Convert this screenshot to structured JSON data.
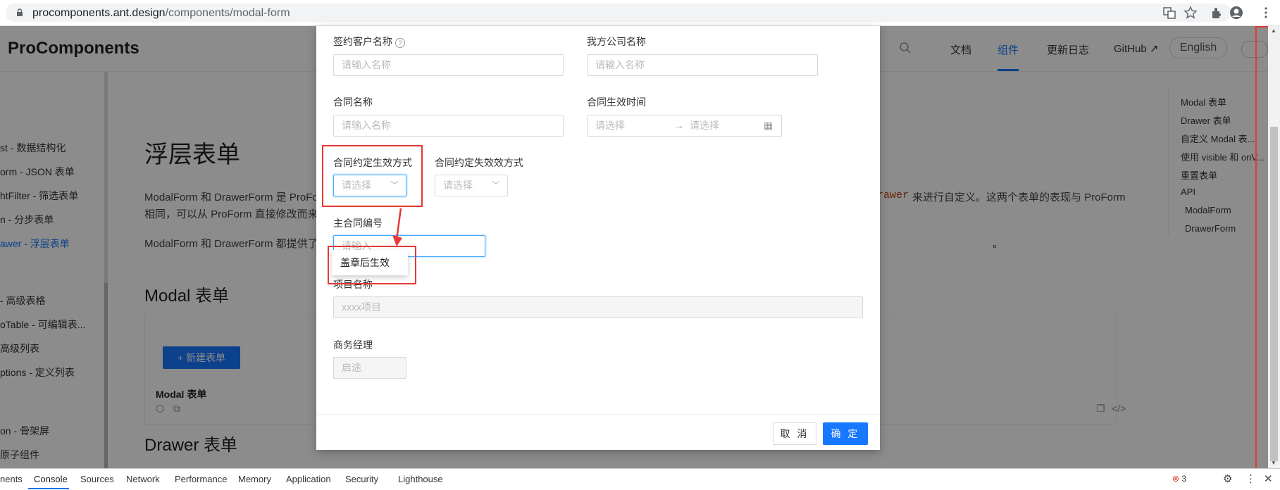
{
  "browser": {
    "url_host": "procomponents.ant.design",
    "url_path": "/components/modal-form"
  },
  "header": {
    "logo": "ProComponents",
    "nav": [
      "文档",
      "组件",
      "更新日志",
      "GitHub",
      "English"
    ],
    "active_nav": "组件"
  },
  "sidebar": {
    "items": [
      "st - 数据结构化",
      "orm - JSON 表单",
      "htFilter - 筛选表单",
      "n - 分步表单",
      "awer - 浮层表单",
      "- 高级表格",
      "oTable - 可编辑表...",
      "高级列表",
      "ptions - 定义列表",
      "on - 骨架屏",
      "原子组件"
    ]
  },
  "content": {
    "title": "浮层表单",
    "para1a": "ModalForm 和 DrawerForm 是 ProFo",
    "para1b": "rawer",
    "para1c": "来进行自定义。这两个表单的表现与 ProForm",
    "para2": "相同，可以从 ProForm 直接修改而来",
    "para3a": "ModalForm 和 DrawerForm 都提供了",
    "para3b": "。",
    "section1": "Modal 表单",
    "new_button": "新建表单",
    "demo_title": "Modal 表单",
    "section2": "Drawer 表单"
  },
  "toc": {
    "items": [
      "Modal 表单",
      "Drawer 表单",
      "自定义 Modal 表...",
      "使用 visible 和 onV...",
      "重置表单",
      "API",
      "ModalForm",
      "DrawerForm"
    ]
  },
  "modal": {
    "fields": {
      "client_name": {
        "label": "签约客户名称",
        "placeholder": "请输入名称"
      },
      "company_name": {
        "label": "我方公司名称",
        "placeholder": "请输入名称"
      },
      "contract_name": {
        "label": "合同名称",
        "placeholder": "请输入名称"
      },
      "effective_time": {
        "label": "合同生效时间",
        "start_placeholder": "请选择",
        "end_placeholder": "请选择"
      },
      "effective_method": {
        "label": "合同约定生效方式",
        "placeholder": "请选择"
      },
      "expire_method": {
        "label": "合同约定失效效方式",
        "placeholder": "请选择"
      },
      "main_contract_no": {
        "label": "主合同编号",
        "placeholder": "请输入"
      },
      "project_name": {
        "label": "项目名称",
        "placeholder": "xxxx项目"
      },
      "business_manager": {
        "label": "商务经理",
        "placeholder": "启途"
      }
    },
    "dropdown_option": "盖章后生效",
    "cancel": "取 消",
    "ok": "确 定"
  },
  "devtools": {
    "tabs": [
      "nents",
      "Console",
      "Sources",
      "Network",
      "Performance",
      "Memory",
      "Application",
      "Security",
      "Lighthouse"
    ],
    "active_tab": "Console",
    "error_count": "3"
  },
  "colors": {
    "primary": "#1677ff",
    "highlight_red": "#e53935"
  }
}
